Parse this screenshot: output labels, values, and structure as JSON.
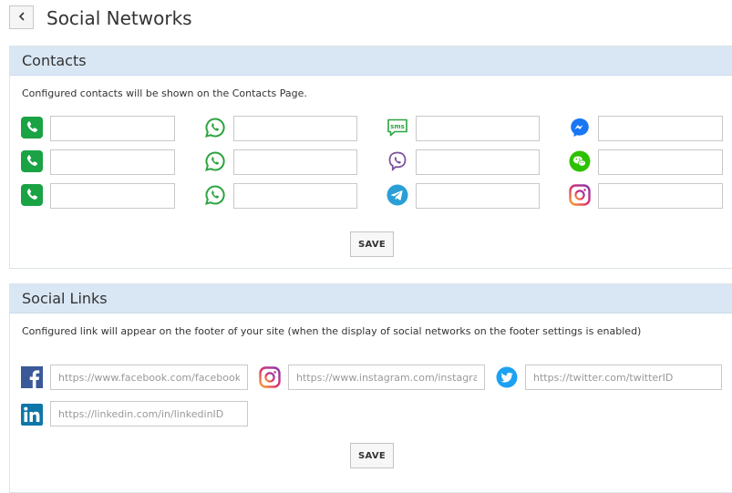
{
  "page": {
    "title": "Social Networks"
  },
  "contacts": {
    "heading": "Contacts",
    "description": "Configured contacts will be shown on the Contacts Page.",
    "save_label": "SAVE",
    "fields": [
      {
        "icon": "phone-icon",
        "value": ""
      },
      {
        "icon": "whatsapp-icon",
        "value": ""
      },
      {
        "icon": "sms-icon",
        "value": ""
      },
      {
        "icon": "messenger-icon",
        "value": ""
      },
      {
        "icon": "phone-icon",
        "value": ""
      },
      {
        "icon": "whatsapp-icon",
        "value": ""
      },
      {
        "icon": "viber-icon",
        "value": ""
      },
      {
        "icon": "wechat-icon",
        "value": ""
      },
      {
        "icon": "phone-icon",
        "value": ""
      },
      {
        "icon": "whatsapp-icon",
        "value": ""
      },
      {
        "icon": "telegram-icon",
        "value": ""
      },
      {
        "icon": "instagram-icon",
        "value": ""
      }
    ]
  },
  "social_links": {
    "heading": "Social Links",
    "description": "Configured link will appear on the footer of your site (when the display of social networks on the footer settings is enabled)",
    "save_label": "SAVE",
    "fields": [
      {
        "icon": "facebook-icon",
        "placeholder": "https://www.facebook.com/facebookID",
        "value": ""
      },
      {
        "icon": "instagram-icon",
        "placeholder": "https://www.instagram.com/instagramID",
        "value": ""
      },
      {
        "icon": "twitter-icon",
        "placeholder": "https://twitter.com/twitterID",
        "value": ""
      },
      {
        "icon": "linkedin-icon",
        "placeholder": "https://linkedin.com/in/linkedinID",
        "value": ""
      }
    ]
  },
  "colors": {
    "header_bg": "#d9e7f4",
    "phone": "#1aa345",
    "whatsapp": "#2ca440",
    "viber": "#7b519d",
    "messenger": "#1877f2",
    "wechat": "#2dc100",
    "telegram": "#2a9fd6",
    "facebook": "#3b5998",
    "twitter": "#1da1f2",
    "linkedin": "#0e76a8"
  }
}
